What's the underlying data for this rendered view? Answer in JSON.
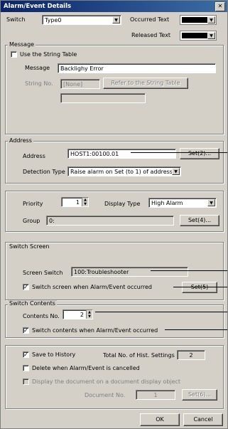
{
  "window": {
    "title": "Alarm/Event Details",
    "close_glyph": "✕"
  },
  "switch_row": {
    "switch_label": "Switch",
    "switch_value": "Type0",
    "occurred_label": "Occurred Text",
    "released_label": "Released Text",
    "occurred_color": "#000000",
    "released_color": "#000000"
  },
  "message": {
    "group_label": "Message",
    "use_string_table_label": "Use the String Table",
    "use_string_table_checked": false,
    "message_label": "Message",
    "message_value": "Backlighy Error",
    "string_no_label": "String No.",
    "string_no_value": "[None]",
    "refer_button": "Refer to the String Table"
  },
  "address": {
    "group_label": "Address",
    "address_label": "Address",
    "address_value": "HOST1:00100.01",
    "set_button": "Set(2)...",
    "detection_label": "Detection Type",
    "detection_value": "Raise alarm on Set (to 1) of address"
  },
  "priority": {
    "priority_label": "Priority",
    "priority_value": "1",
    "display_type_label": "Display Type",
    "display_type_value": "High Alarm",
    "group_label": "Group",
    "group_value": "0:",
    "set_button": "Set(4)..."
  },
  "switch_screen": {
    "group_label": "Switch Screen",
    "screen_switch_label": "Screen Switch",
    "screen_switch_value": "100:Troubleshooter",
    "switch_when_label": "Switch screen when Alarm/Event occurred",
    "switch_when_checked": true,
    "set_button": "Set(5)"
  },
  "switch_contents": {
    "group_label": "Switch Contents",
    "contents_no_label": "Contents No.",
    "contents_no_value": "2",
    "switch_contents_label": "Switch contents when Alarm/Event occurred",
    "switch_contents_checked": true
  },
  "history": {
    "save_history_label": "Save to History",
    "save_history_checked": true,
    "total_label": "Total No. of Hist. Settings",
    "total_value": "2",
    "delete_label": "Delete when Alarm/Event is cancelled",
    "delete_checked": false,
    "display_doc_label": "Display the document on a document display object",
    "document_no_label": "Document No.",
    "document_no_value": "1",
    "set_button": "Set(6)..."
  },
  "footer": {
    "ok": "OK",
    "cancel": "Cancel"
  },
  "icons": {
    "dropdown": "▼",
    "spin_up": "▲",
    "spin_down": "▼",
    "check": "✓"
  },
  "colors": {
    "titlebar_start": "#0a246a",
    "titlebar_end": "#3a6ea5",
    "dialog_bg": "#d4d0c8"
  }
}
